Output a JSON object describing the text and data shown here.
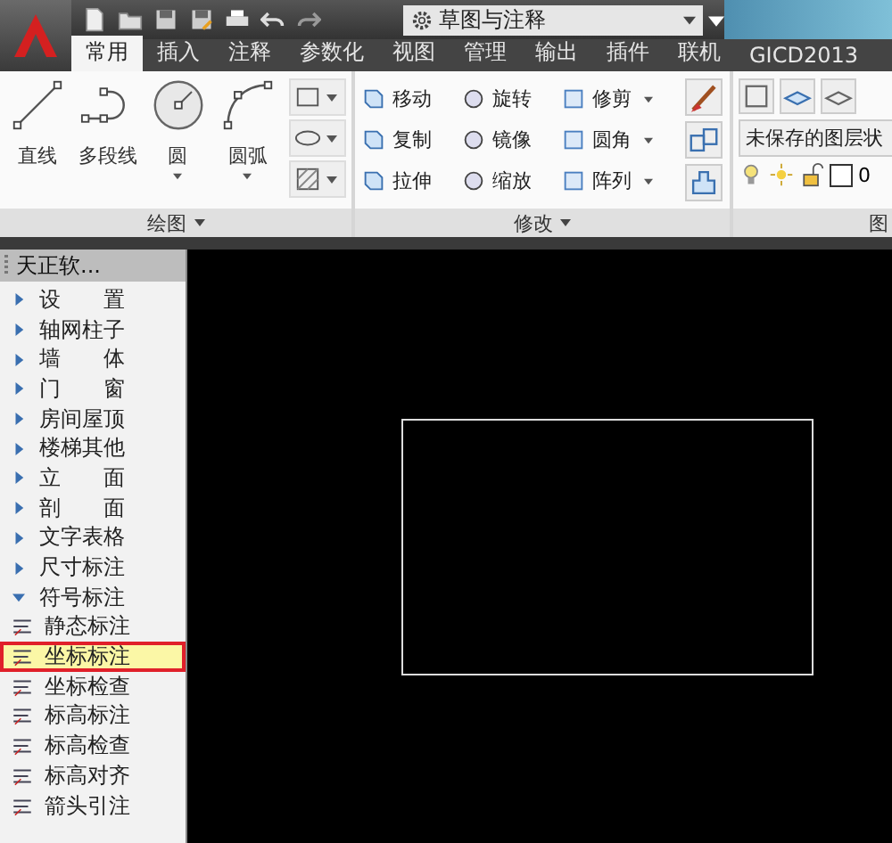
{
  "workspace": {
    "value": "草图与注释"
  },
  "tabs": [
    {
      "label": "常用",
      "selected": true
    },
    {
      "label": "插入",
      "selected": false
    },
    {
      "label": "注释",
      "selected": false
    },
    {
      "label": "参数化",
      "selected": false
    },
    {
      "label": "视图",
      "selected": false
    },
    {
      "label": "管理",
      "selected": false
    },
    {
      "label": "输出",
      "selected": false
    },
    {
      "label": "插件",
      "selected": false
    },
    {
      "label": "联机",
      "selected": false
    },
    {
      "label": "GICD2013",
      "selected": false
    }
  ],
  "draw_panel": {
    "title": "绘图",
    "tools": [
      {
        "label": "直线",
        "dropdown": false
      },
      {
        "label": "多段线",
        "dropdown": false
      },
      {
        "label": "圆",
        "dropdown": true
      },
      {
        "label": "圆弧",
        "dropdown": true
      }
    ]
  },
  "modify_panel": {
    "title": "修改",
    "rows": [
      [
        {
          "label": "移动",
          "dropdown": false
        },
        {
          "label": "旋转",
          "dropdown": false
        },
        {
          "label": "修剪",
          "dropdown": true
        }
      ],
      [
        {
          "label": "复制",
          "dropdown": false
        },
        {
          "label": "镜像",
          "dropdown": false
        },
        {
          "label": "圆角",
          "dropdown": true
        }
      ],
      [
        {
          "label": "拉伸",
          "dropdown": false
        },
        {
          "label": "缩放",
          "dropdown": false
        },
        {
          "label": "阵列",
          "dropdown": true
        }
      ]
    ]
  },
  "layers_panel": {
    "title": "图",
    "layer_state": "未保存的图层状",
    "current_layer": "0"
  },
  "sidebar": {
    "title": "天正软...",
    "items": [
      {
        "label": "设　　置",
        "expanded": false
      },
      {
        "label": "轴网柱子",
        "expanded": false
      },
      {
        "label": "墙　　体",
        "expanded": false
      },
      {
        "label": "门　　窗",
        "expanded": false
      },
      {
        "label": "房间屋顶",
        "expanded": false
      },
      {
        "label": "楼梯其他",
        "expanded": false
      },
      {
        "label": "立　　面",
        "expanded": false
      },
      {
        "label": "剖　　面",
        "expanded": false
      },
      {
        "label": "文字表格",
        "expanded": false
      },
      {
        "label": "尺寸标注",
        "expanded": false
      },
      {
        "label": "符号标注",
        "expanded": true,
        "children": [
          {
            "label": "静态标注",
            "selected": false
          },
          {
            "label": "坐标标注",
            "selected": true
          },
          {
            "label": "坐标检查",
            "selected": false
          },
          {
            "label": "标高标注",
            "selected": false
          },
          {
            "label": "标高检查",
            "selected": false
          },
          {
            "label": "标高对齐",
            "selected": false
          },
          {
            "label": "箭头引注",
            "selected": false
          }
        ]
      }
    ]
  }
}
